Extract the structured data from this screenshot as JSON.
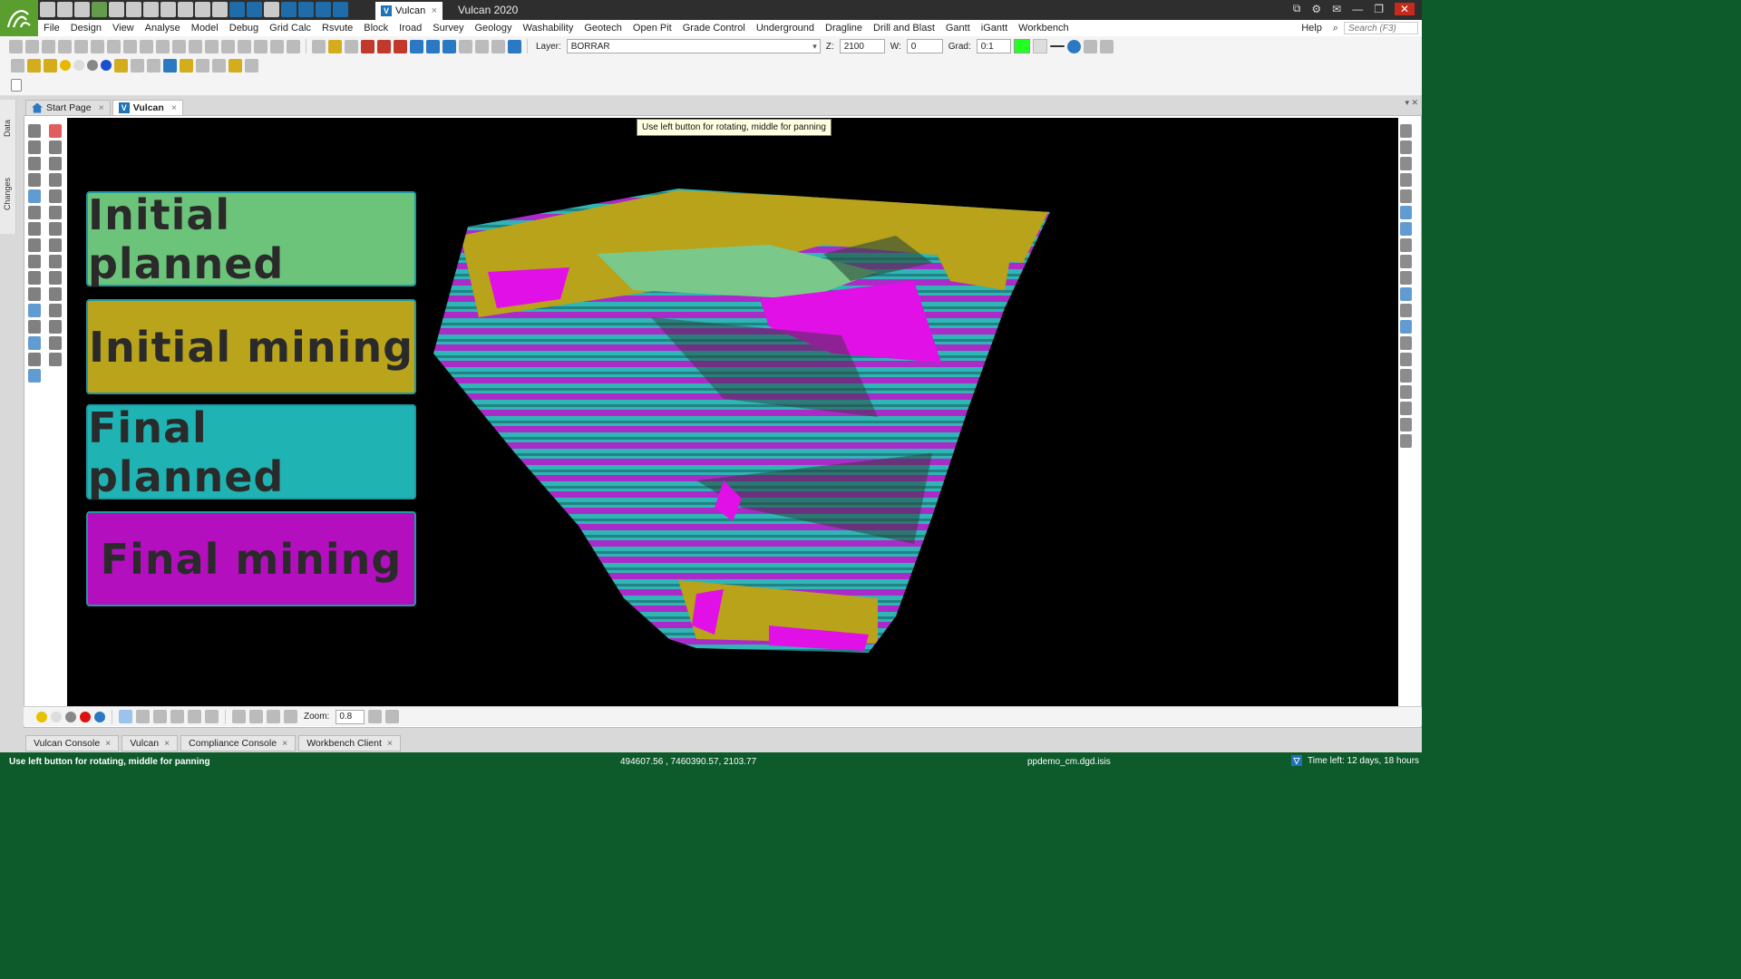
{
  "window": {
    "tab_label": "Vulcan",
    "app_title": "Vulcan 2020"
  },
  "menu": {
    "items": [
      "File",
      "Design",
      "View",
      "Analyse",
      "Model",
      "Debug",
      "Grid Calc",
      "Rsvute",
      "Block",
      "Iroad",
      "Survey",
      "Geology",
      "Washability",
      "Geotech",
      "Open Pit",
      "Grade Control",
      "Underground",
      "Dragline",
      "Drill and Blast",
      "Gantt",
      "iGantt",
      "Workbench"
    ],
    "help": "Help",
    "search_placeholder": "Search (F3)"
  },
  "toolbar": {
    "layer_label": "Layer:",
    "layer_value": "BORRAR",
    "z_label": "Z:",
    "z_value": "2100",
    "w_label": "W:",
    "w_value": "0",
    "grad_label": "Grad:",
    "grad_value": "0:1"
  },
  "side_tabs": {
    "data": "Data",
    "changes": "Changes"
  },
  "doc_tabs": [
    {
      "label": "Start Page"
    },
    {
      "label": "Vulcan"
    }
  ],
  "viewport": {
    "tooltip": "Use left button for rotating, middle for panning",
    "legend": [
      {
        "label": "Initial planned",
        "color": "#6cc47b"
      },
      {
        "label": "Initial mining",
        "color": "#b9a41b"
      },
      {
        "label": "Final planned",
        "color": "#1fb3b3"
      },
      {
        "label": "Final mining",
        "color": "#b40fbf"
      }
    ]
  },
  "bottom_toolbar": {
    "zoom_label": "Zoom:",
    "zoom_value": "0.8"
  },
  "console_tabs": [
    "Vulcan Console",
    "Vulcan",
    "Compliance Console",
    "Workbench Client"
  ],
  "status": {
    "hint": "Use left button for rotating, middle for panning",
    "coordinates": "494607.56 , 7460390.57, 2103.77",
    "file": "ppdemo_cm.dgd.isis",
    "licence": "Time left: 12 days, 18 hours"
  }
}
